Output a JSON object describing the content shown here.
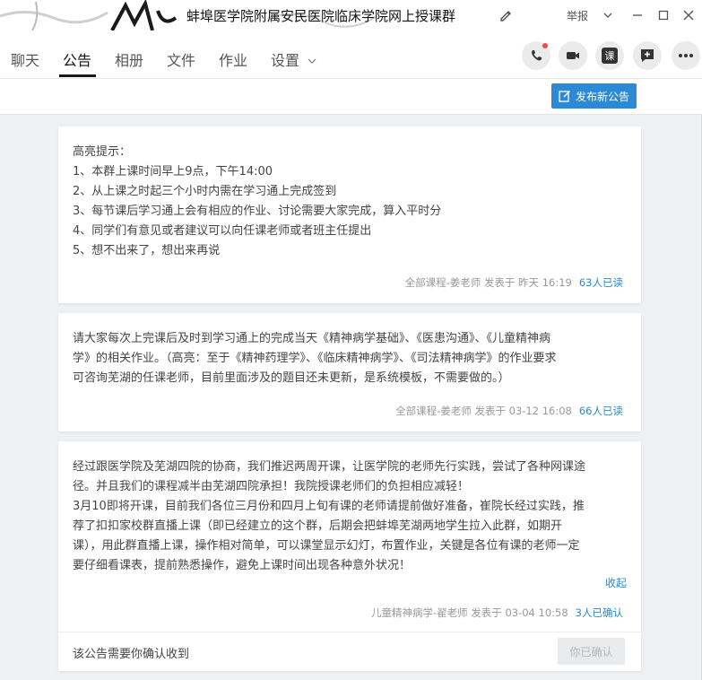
{
  "window": {
    "title": "蚌埠医学院附属安民医院临床学院网上授课群",
    "report_label": "举报"
  },
  "nav": {
    "tabs": [
      {
        "label": "聊天"
      },
      {
        "label": "公告"
      },
      {
        "label": "相册"
      },
      {
        "label": "文件"
      },
      {
        "label": "作业"
      },
      {
        "label": "设置"
      }
    ],
    "active_tab": "公告",
    "class_button_label": "课"
  },
  "toolbar": {
    "publish_label": "发布新公告"
  },
  "announcements": [
    {
      "lines": [
        "高亮提示：",
        "1、本群上课时间早上9点，下午14:00",
        "2、从上课之时起三个小时内需在学习通上完成签到",
        "3、每节课后学习通上会有相应的作业、讨论需要大家完成，算入平时分",
        "4、同学们有意见或者建议可以向任课老师或者班主任提出",
        "5、想不出来了，想出来再说"
      ],
      "meta": "全部课程-姜老师 发表于 昨天 16:19",
      "reads": "63人已读"
    },
    {
      "lines": [
        "请大家每次上完课后及时到学习通上的完成当天《精神病学基础》、《医患沟通》、《儿童精神病",
        "学》的相关作业。（高亮：至于《精神药理学》、《临床精神病学》、《司法精神病学》的作业要求",
        "可咨询芜湖的任课老师，目前里面涉及的题目还未更新，是系统模板，不需要做的。）"
      ],
      "meta": "全部课程-姜老师 发表于 03-12 16:08",
      "reads": "66人已读"
    },
    {
      "lines": [
        "经过跟医学院及芜湖四院的协商，我们推迟两周开课，让医学院的老师先行实践，尝试了各种网课途",
        "径。并且我们的课程减半由芜湖四院承担！我院授课老师们的负担相应减轻！",
        "3月10即将开课，目前我们各位三月份和四月上旬有课的老师请提前做好准备，崔院长经过实践，推",
        "荐了扣扣家校群直播上课（即已经建立的这个群，后期会把蚌埠芜湖两地学生拉入此群，如期开",
        "课），用此群直播上课，操作相对简单，可以课堂显示幻灯，布置作业，关键是各位有课的老师一定",
        "要仔细看课表，提前熟悉操作，避免上课时间出现各种意外状况！"
      ],
      "collapse_label": "收起",
      "meta": "儿童精神病学-翟老师 发表于 03-04 10:58",
      "reads": "3人已确认",
      "confirm_text": "该公告需要你确认收到",
      "confirm_button": "你已确认"
    }
  ],
  "colors": {
    "accent": "#2b89d6",
    "background": "#eef0f4",
    "notify_dot": "#f04a4a"
  }
}
